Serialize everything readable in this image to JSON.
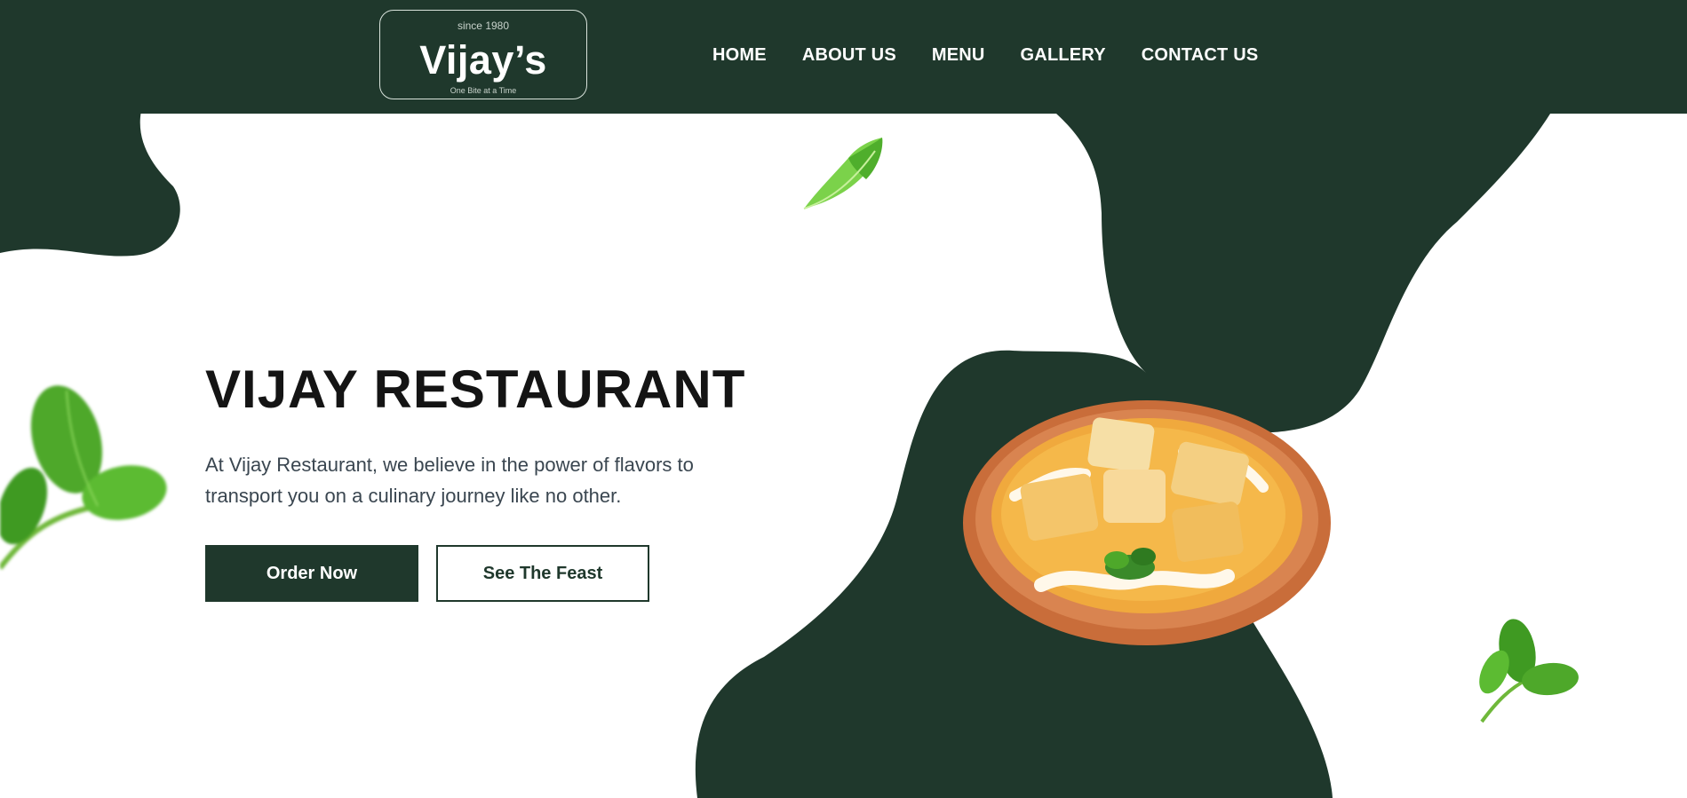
{
  "logo": {
    "since": "since 1980",
    "name": "Vijay’s",
    "tagline": "One Bite at a Time"
  },
  "nav": {
    "items": [
      {
        "label": "HOME"
      },
      {
        "label": "ABOUT US"
      },
      {
        "label": "MENU"
      },
      {
        "label": "GALLERY"
      },
      {
        "label": "CONTACT US"
      }
    ]
  },
  "hero": {
    "title": "VIJAY RESTAURANT",
    "description": "At Vijay Restaurant, we believe in the power of flavors to transport you on a culinary journey like no other.",
    "primary_button": "Order Now",
    "secondary_button": "See The Feast"
  },
  "images": {
    "dish": "paneer-curry-plate",
    "leaves": [
      "lettuce-leaf",
      "basil-leaves-left",
      "basil-leaves-right"
    ]
  },
  "colors": {
    "brand": "#1f382c",
    "background": "#ffffff",
    "title_text": "#141414",
    "body_text": "#3a4650"
  }
}
